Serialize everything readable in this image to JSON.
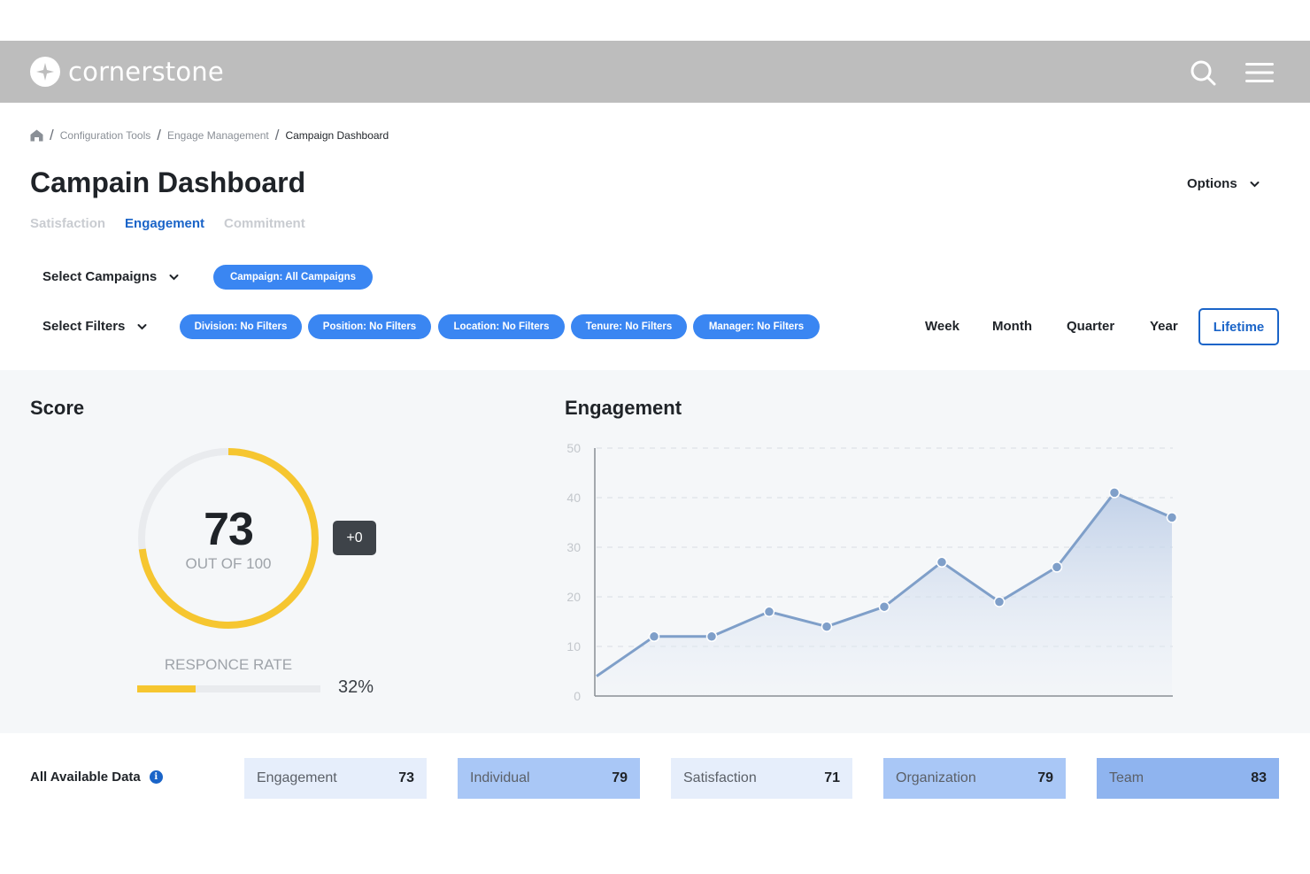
{
  "header": {
    "brand": "cornerstone",
    "search_icon": "search-icon",
    "menu_icon": "hamburger-menu-icon"
  },
  "breadcrumb": {
    "items": [
      "Configuration Tools",
      "Engage Management"
    ],
    "current": "Campaign Dashboard"
  },
  "page": {
    "title": "Campain Dashboard",
    "options_label": "Options"
  },
  "tabs": [
    {
      "label": "Satisfaction",
      "active": false
    },
    {
      "label": "Engagement",
      "active": true
    },
    {
      "label": "Commitment",
      "active": false
    }
  ],
  "filters": {
    "select_campaigns": "Select Campaigns",
    "campaign_chip": "Campaign: All Campaigns",
    "select_filters": "Select Filters",
    "chips": [
      "Division: No Filters",
      "Position: No Filters",
      "Location: No Filters",
      "Tenure: No Filters",
      "Manager: No Filters"
    ]
  },
  "periods": {
    "options": [
      "Week",
      "Month",
      "Quarter",
      "Year"
    ],
    "selected": "Lifetime"
  },
  "score": {
    "title": "Score",
    "value": "73",
    "value_num": 73,
    "out_of": "OUT OF 100",
    "max": 100,
    "delta": "+0",
    "response_label": "RESPONCE RATE",
    "response_rate": "32%",
    "response_rate_fraction": 0.32
  },
  "engagement": {
    "title": "Engagement"
  },
  "chart_data": {
    "type": "area",
    "title": "Engagement",
    "y_ticks": [
      "0",
      "10",
      "20",
      "30",
      "40",
      "50"
    ],
    "ylim": [
      0,
      50
    ],
    "x": [
      0,
      1,
      2,
      3,
      4,
      5,
      6,
      7,
      8,
      9,
      10
    ],
    "values": [
      4,
      12,
      12,
      17,
      14,
      18,
      27,
      19,
      26,
      41,
      36
    ],
    "grid": true
  },
  "summary": {
    "label": "All Available Data",
    "info_icon": "info-icon",
    "metrics": [
      {
        "label": "Engagement",
        "value": "73",
        "color": "#e6eefb"
      },
      {
        "label": "Individual",
        "value": "79",
        "color": "#a9c7f6"
      },
      {
        "label": "Satisfaction",
        "value": "71",
        "color": "#e6eefb"
      },
      {
        "label": "Organization",
        "value": "79",
        "color": "#a9c7f6"
      },
      {
        "label": "Team",
        "value": "83",
        "color": "#8fb4ef"
      }
    ]
  },
  "colors": {
    "accent": "#1a64c8",
    "chip": "#3a86f2",
    "gauge": "#f6c630",
    "line": "#7f9fc9"
  }
}
